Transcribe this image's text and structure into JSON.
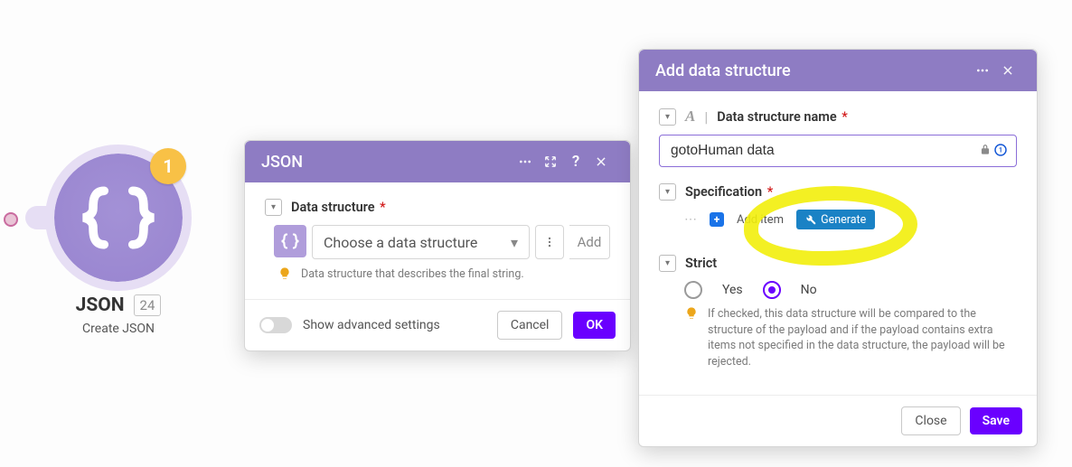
{
  "node": {
    "badge": "1",
    "title": "JSON",
    "countBadge": "24",
    "subtitle": "Create JSON"
  },
  "jsonPanel": {
    "title": "JSON",
    "field": {
      "label": "Data structure",
      "selectPlaceholder": "Choose a data structure",
      "addLabel": "Add",
      "hint": "Data structure that describes the final string."
    },
    "advancedToggle": "Show advanced settings",
    "cancel": "Cancel",
    "ok": "OK"
  },
  "dsPanel": {
    "title": "Add data structure",
    "nameLabel": "Data structure name",
    "nameValue": "gotoHuman data",
    "specLabel": "Specification",
    "addItem": "Add item",
    "generate": "Generate",
    "strictLabel": "Strict",
    "yes": "Yes",
    "no": "No",
    "strictHint": "If checked, this data structure will be compared to the structure of the payload and if the payload contains extra items not specified in the data structure, the payload will be rejected.",
    "close": "Close",
    "save": "Save"
  }
}
